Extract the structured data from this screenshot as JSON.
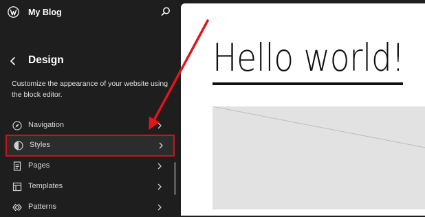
{
  "header": {
    "site_title": "My Blog"
  },
  "panel": {
    "title": "Design",
    "description": "Customize the appearance of your website using the block editor."
  },
  "nav": {
    "items": [
      {
        "label": "Navigation",
        "icon": "compass-icon"
      },
      {
        "label": "Styles",
        "icon": "half-circle-icon",
        "highlighted": true
      },
      {
        "label": "Pages",
        "icon": "page-icon"
      },
      {
        "label": "Templates",
        "icon": "layout-icon"
      },
      {
        "label": "Patterns",
        "icon": "diamond-icon"
      }
    ]
  },
  "preview": {
    "heading": "Hello world!"
  },
  "colors": {
    "sidebar_bg": "#1e1e1e",
    "highlight_border": "#c8141e",
    "annotation_arrow": "#e0151b",
    "canvas_bg": "#ffffff",
    "placeholder_bg": "#e2e2e2"
  }
}
